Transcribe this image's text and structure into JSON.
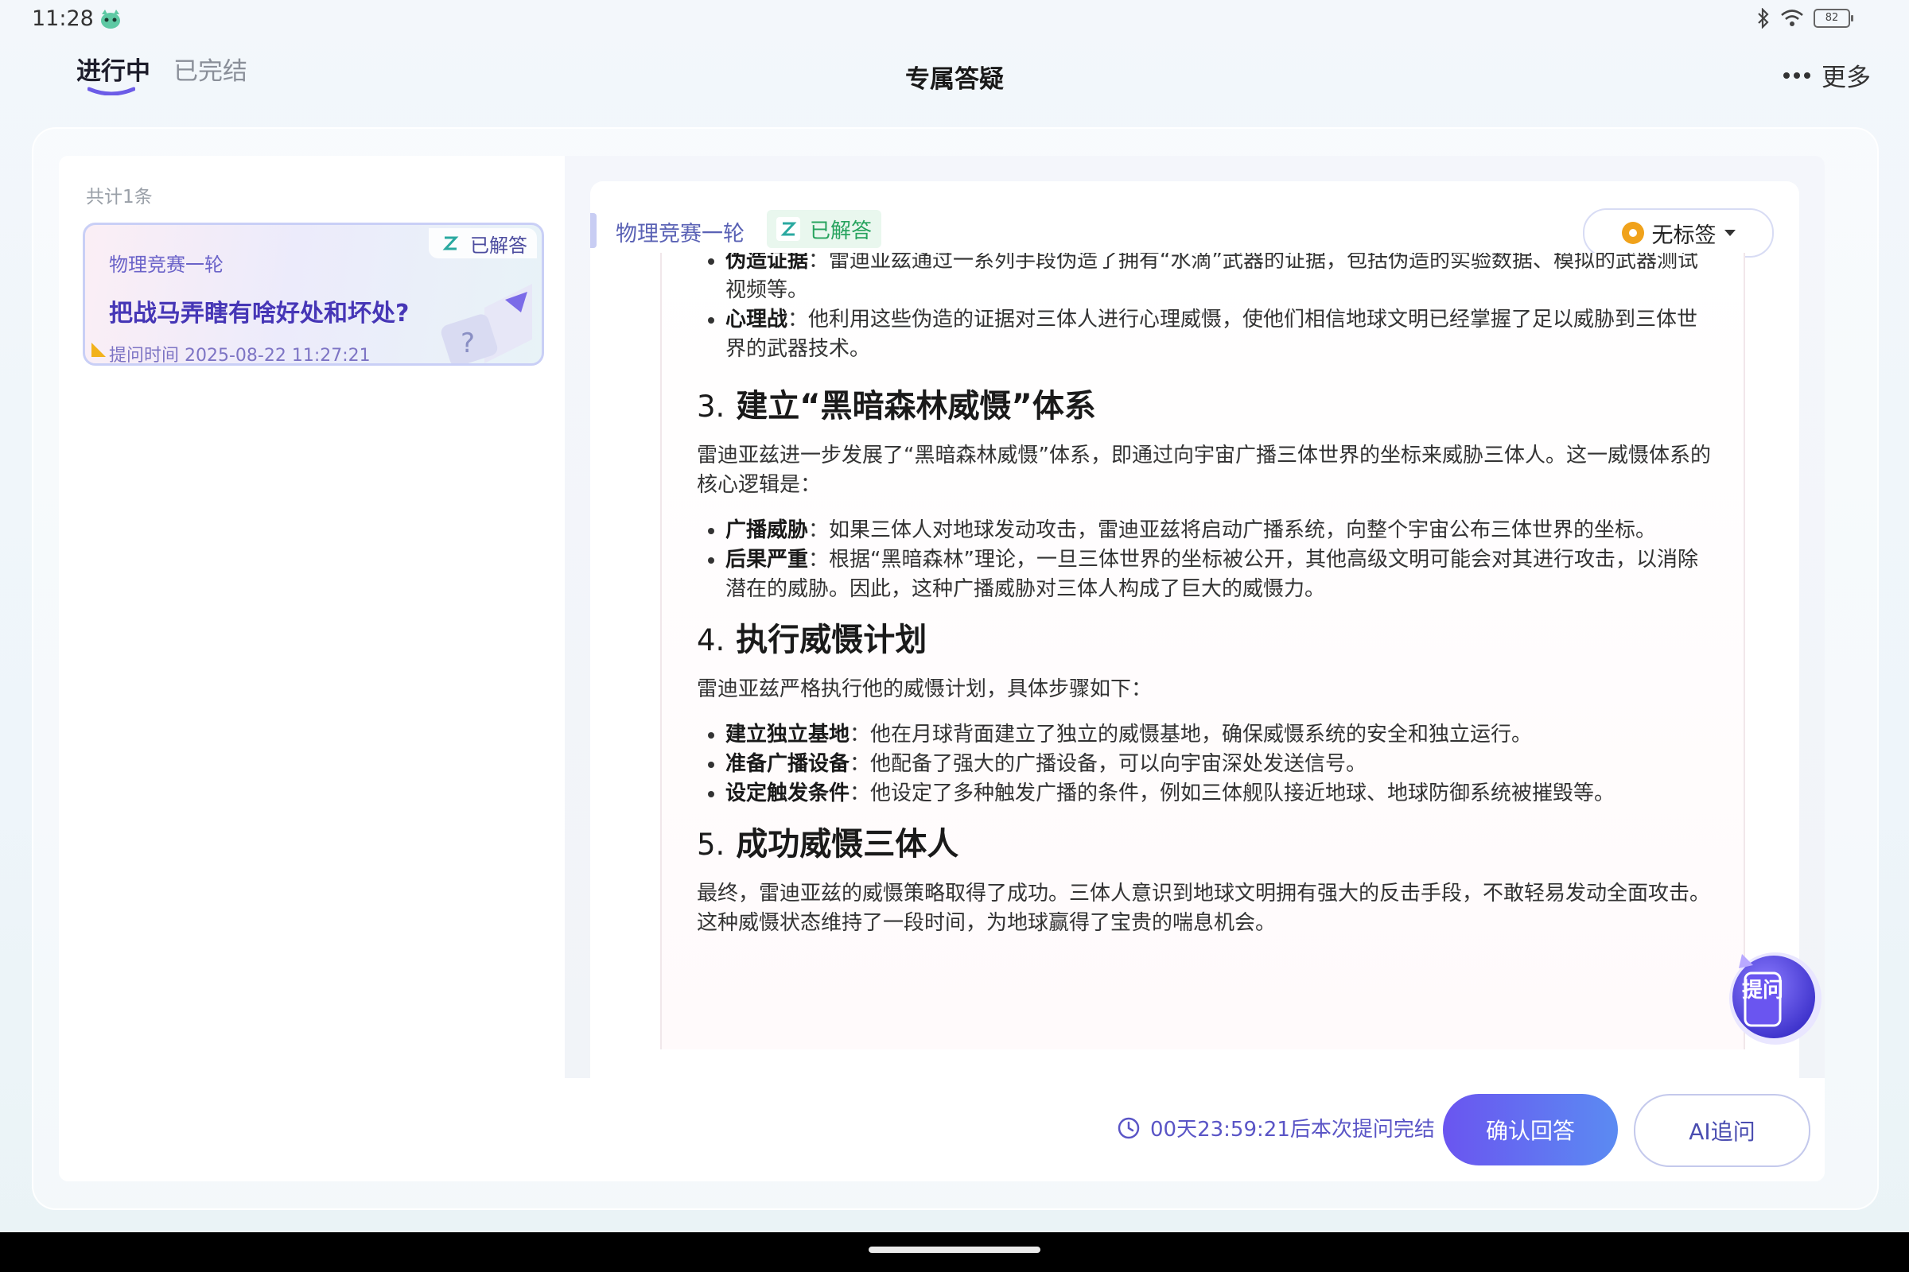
{
  "status_bar": {
    "time": "11:28",
    "battery": "82"
  },
  "header": {
    "tabs": [
      {
        "label": "进行中",
        "active": true
      },
      {
        "label": "已完结",
        "active": false
      }
    ],
    "title": "专属答疑",
    "more_label": "更多"
  },
  "left_panel": {
    "count_label": "共计1条",
    "questions": [
      {
        "subject": "物理竞赛一轮",
        "status": "已解答",
        "title": "把战马弄瞎有啥好处和坏处?",
        "time": "提问时间 2025-08-22 11:27:21"
      }
    ]
  },
  "answer": {
    "subject": "物理竞赛一轮",
    "status": "已解答",
    "tag_label": "无标签",
    "top_bullets": [
      {
        "term": "伪造证据",
        "text": "：雷迪亚兹通过一系列手段伪造了拥有“水滴”武器的证据，包括伪造的实验数据、模拟的武器测试视频等。"
      },
      {
        "term": "心理战",
        "text": "：他利用这些伪造的证据对三体人进行心理威慑，使他们相信地球文明已经掌握了足以威胁到三体世界的武器技术。"
      }
    ],
    "sections": [
      {
        "num": "3.",
        "heading": "建立“黑暗森林威慑”体系",
        "intro": "雷迪亚兹进一步发展了“黑暗森林威慑”体系，即通过向宇宙广播三体世界的坐标来威胁三体人。这一威慑体系的核心逻辑是：",
        "bullets": [
          {
            "term": "广播威胁",
            "text": "：如果三体人对地球发动攻击，雷迪亚兹将启动广播系统，向整个宇宙公布三体世界的坐标。"
          },
          {
            "term": "后果严重",
            "text": "：根据“黑暗森林”理论，一旦三体世界的坐标被公开，其他高级文明可能会对其进行攻击，以消除潜在的威胁。因此，这种广播威胁对三体人构成了巨大的威慑力。"
          }
        ]
      },
      {
        "num": "4.",
        "heading": "执行威慑计划",
        "intro": "雷迪亚兹严格执行他的威慑计划，具体步骤如下：",
        "bullets": [
          {
            "term": "建立独立基地",
            "text": "：他在月球背面建立了独立的威慑基地，确保威慑系统的安全和独立运行。"
          },
          {
            "term": "准备广播设备",
            "text": "：他配备了强大的广播设备，可以向宇宙深处发送信号。"
          },
          {
            "term": "设定触发条件",
            "text": "：他设定了多种触发广播的条件，例如三体舰队接近地球、地球防御系统被摧毁等。"
          }
        ]
      },
      {
        "num": "5.",
        "heading": "成功威慑三体人",
        "intro": "最终，雷迪亚兹的威慑策略取得了成功。三体人意识到地球文明拥有强大的反击手段，不敢轻易发动全面攻击。这种威慑状态维持了一段时间，为地球赢得了宝贵的喘息机会。",
        "bullets": []
      }
    ],
    "fab_label": "提问"
  },
  "footer": {
    "countdown": "00天23:59:21后本次提问完结",
    "confirm_label": "确认回答",
    "ai_label": "AI追问"
  },
  "colors": {
    "accent": "#6a55f0",
    "success": "#27a35e",
    "tag": "#f0a21b"
  }
}
